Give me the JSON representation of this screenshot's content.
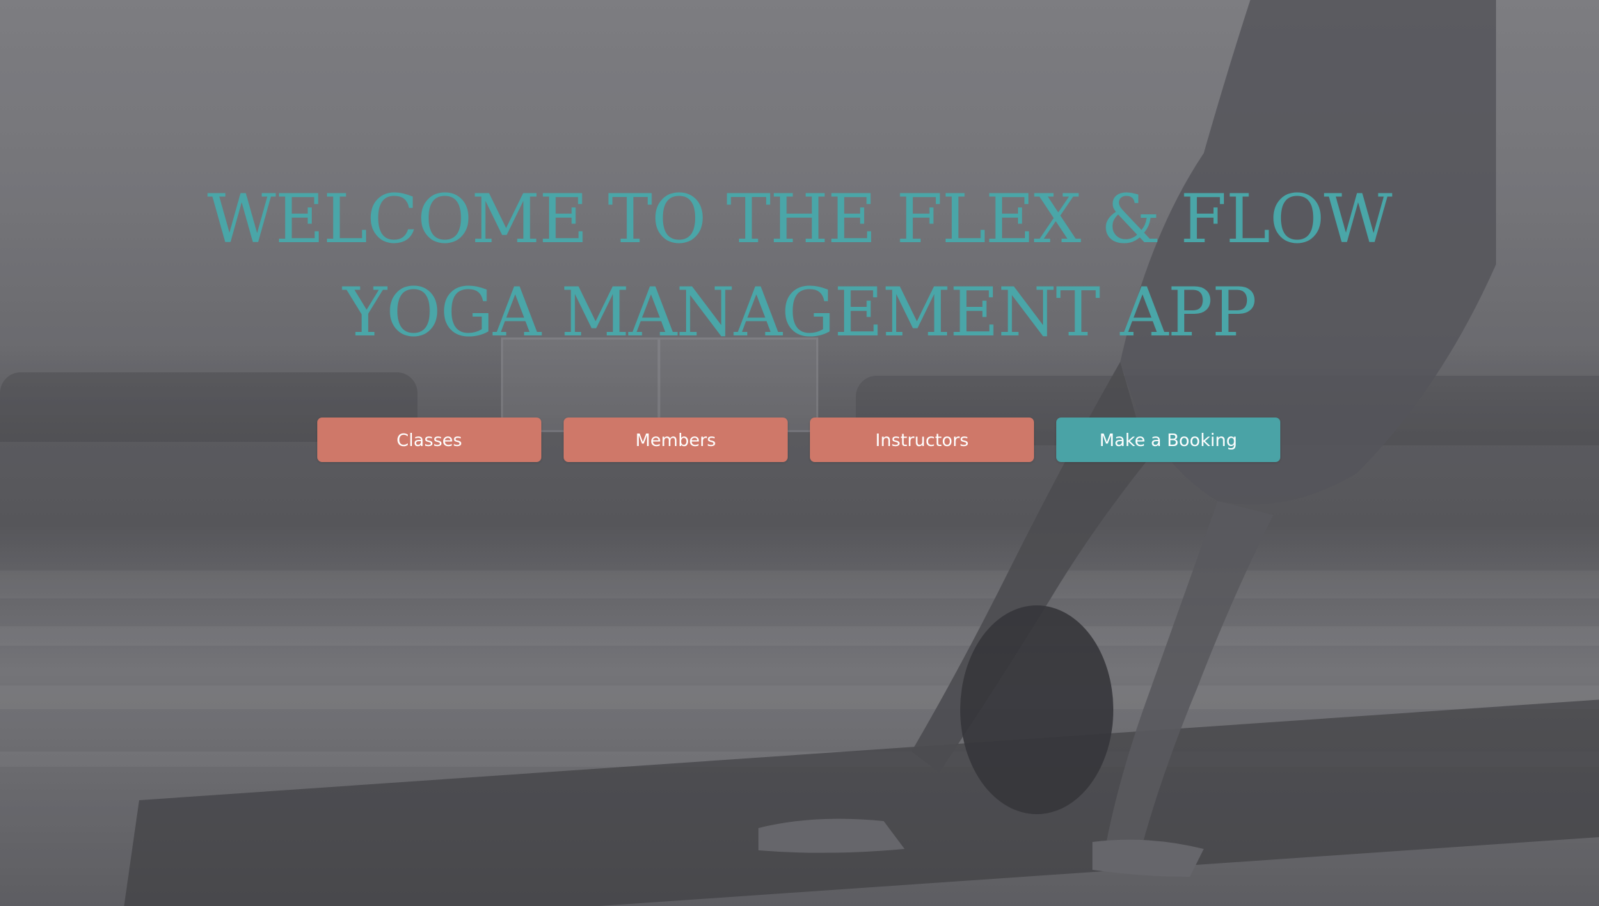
{
  "hero": {
    "title": "WELCOME TO THE FLEX & FLOW YOGA MANAGEMENT APP",
    "background_image": "grayscale photo of a person in downward-facing dog pose on a yoga mat in a studio"
  },
  "nav": {
    "buttons": [
      {
        "label": "Classes",
        "variant": "secondary"
      },
      {
        "label": "Members",
        "variant": "secondary"
      },
      {
        "label": "Instructors",
        "variant": "secondary"
      },
      {
        "label": "Make a Booking",
        "variant": "primary"
      }
    ]
  },
  "colors": {
    "title": "#4aa6a8",
    "secondary_button": "#cf7869",
    "primary_button": "#4aa3a6",
    "button_text": "#ffffff"
  }
}
